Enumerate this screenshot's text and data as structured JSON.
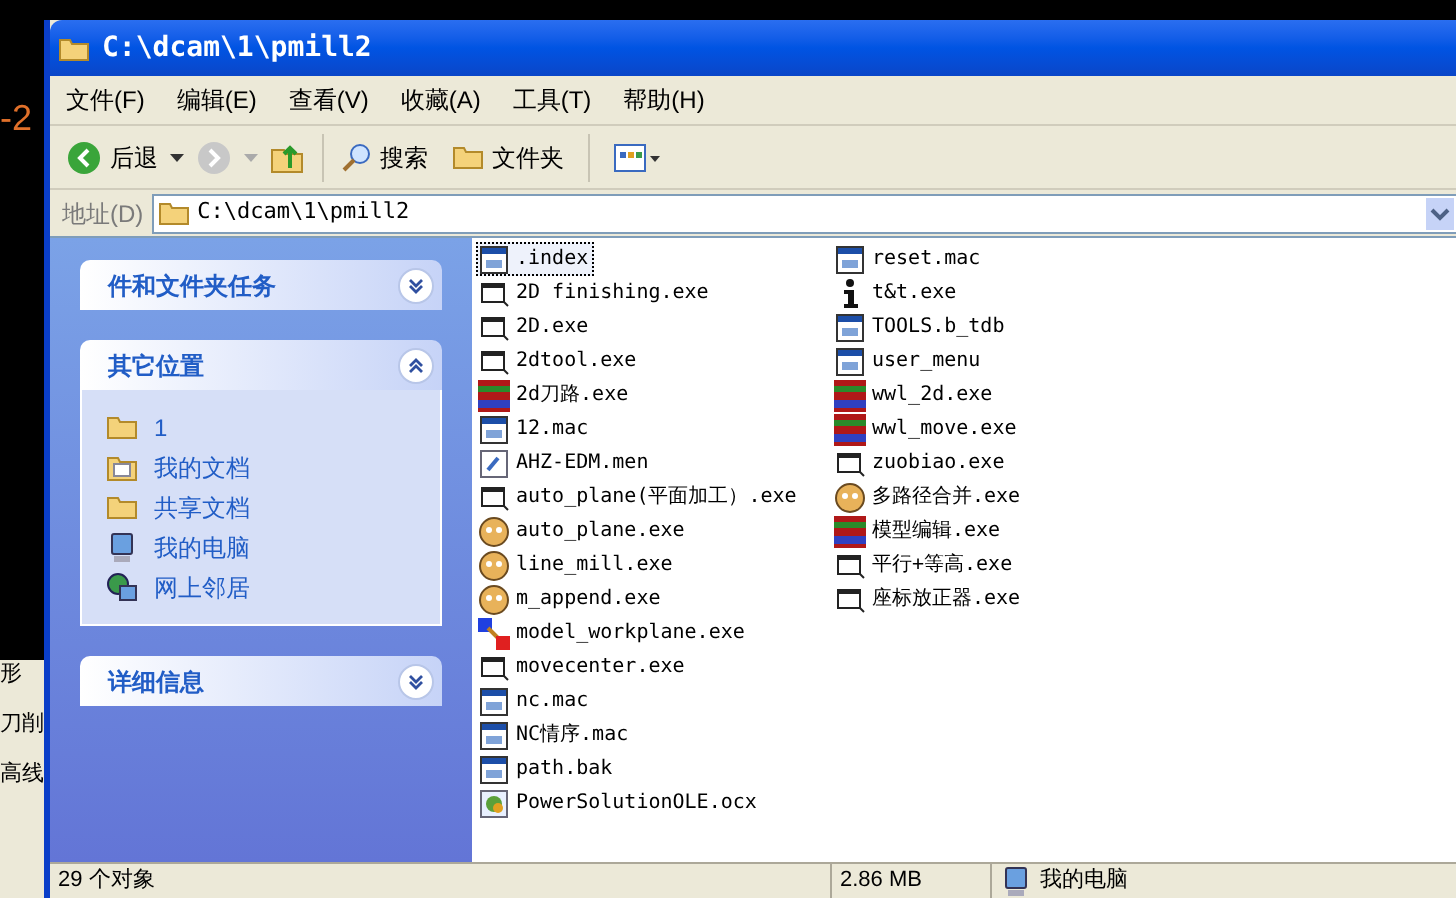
{
  "background": {
    "marker": "-2",
    "labels": [
      "形",
      "刀削",
      "高线"
    ]
  },
  "window": {
    "title": "C:\\dcam\\1\\pmill2"
  },
  "menu": [
    "文件(F)",
    "编辑(E)",
    "查看(V)",
    "收藏(A)",
    "工具(T)",
    "帮助(H)"
  ],
  "toolbar": {
    "back": "后退",
    "search": "搜索",
    "folders": "文件夹"
  },
  "address": {
    "label": "地址(D)",
    "value": "C:\\dcam\\1\\pmill2"
  },
  "sidebar": [
    {
      "title": "件和文件夹任务",
      "expanded": false
    },
    {
      "title": "其它位置",
      "expanded": true,
      "items": [
        {
          "label": "1",
          "kind": "folder"
        },
        {
          "label": "我的文档",
          "kind": "documents"
        },
        {
          "label": "共享文档",
          "kind": "folder"
        },
        {
          "label": "我的电脑",
          "kind": "computer"
        },
        {
          "label": "网上邻居",
          "kind": "network"
        }
      ]
    },
    {
      "title": "详细信息",
      "expanded": false
    }
  ],
  "files": [
    [
      {
        "name": ".index",
        "kind": "window",
        "selected": true
      },
      {
        "name": "2D finishing.exe",
        "kind": "exe",
        "selected": false
      },
      {
        "name": "2D.exe",
        "kind": "exe",
        "selected": false
      },
      {
        "name": "2dtool.exe",
        "kind": "exe",
        "selected": false
      },
      {
        "name": "2d刀路.exe",
        "kind": "colorful",
        "selected": false
      },
      {
        "name": "12.mac",
        "kind": "window",
        "selected": false
      },
      {
        "name": "AHZ-EDM.men",
        "kind": "note",
        "selected": false
      },
      {
        "name": "auto_plane(平面加工）.exe",
        "kind": "exe",
        "selected": false
      },
      {
        "name": "auto_plane.exe",
        "kind": "avatar",
        "selected": false
      },
      {
        "name": "line_mill.exe",
        "kind": "avatar",
        "selected": false
      },
      {
        "name": "m_append.exe",
        "kind": "avatar",
        "selected": false
      },
      {
        "name": "model_workplane.exe",
        "kind": "workplane",
        "selected": false
      },
      {
        "name": "movecenter.exe",
        "kind": "exe",
        "selected": false
      },
      {
        "name": "nc.mac",
        "kind": "window",
        "selected": false
      },
      {
        "name": "NC情序.mac",
        "kind": "window",
        "selected": false
      },
      {
        "name": "path.bak",
        "kind": "window",
        "selected": false
      },
      {
        "name": "PowerSolutionOLE.ocx",
        "kind": "ocx",
        "selected": false
      }
    ],
    [
      {
        "name": "reset.mac",
        "kind": "window",
        "selected": false
      },
      {
        "name": "t&t.exe",
        "kind": "info",
        "selected": false
      },
      {
        "name": "TOOLS.b_tdb",
        "kind": "window",
        "selected": false
      },
      {
        "name": "user_menu",
        "kind": "window",
        "selected": false
      },
      {
        "name": "wwl_2d.exe",
        "kind": "colorful",
        "selected": false
      },
      {
        "name": "wwl_move.exe",
        "kind": "colorful",
        "selected": false
      },
      {
        "name": "zuobiao.exe",
        "kind": "exe",
        "selected": false
      },
      {
        "name": "多路径合并.exe",
        "kind": "avatar",
        "selected": false
      },
      {
        "name": "模型编辑.exe",
        "kind": "colorful",
        "selected": false
      },
      {
        "name": "平行+等高.exe",
        "kind": "exe",
        "selected": false
      },
      {
        "name": "座标放正器.exe",
        "kind": "exe",
        "selected": false
      }
    ]
  ],
  "status_bar": {
    "objects": "29 个对象",
    "size": "2.86 MB",
    "location": "我的电脑"
  }
}
